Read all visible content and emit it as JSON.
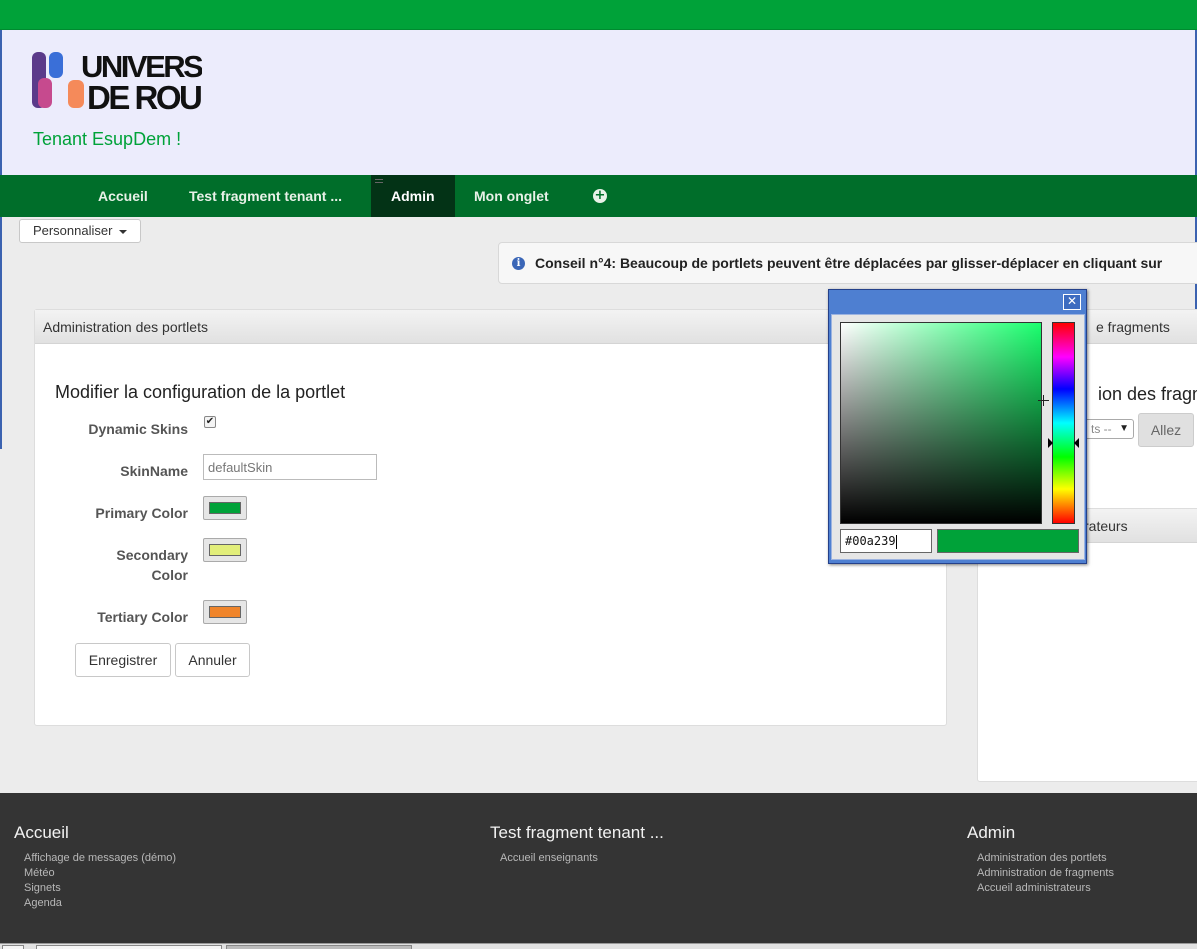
{
  "header": {
    "tenant_title": "Tenant EsupDem !",
    "logo_alt": "UNIVERSITÉ DE ROUEN",
    "logo_line1": "UNIVERSITÉ",
    "logo_line2": "DE ROUEN"
  },
  "nav": {
    "items": [
      {
        "label": "Accueil"
      },
      {
        "label": "Test fragment tenant ..."
      },
      {
        "label": "Admin"
      },
      {
        "label": "Mon onglet"
      }
    ],
    "add_icon": "plus-circle-icon"
  },
  "toolbar": {
    "personnaliser_label": "Personnaliser"
  },
  "tip": {
    "text": "Conseil n°4: Beaucoup de portlets peuvent être déplacées par glisser-déplacer en cliquant sur"
  },
  "portlet": {
    "header": "Administration des portlets",
    "form_title": "Modifier la configuration de la portlet",
    "fields": {
      "dynamic_skins_label": "Dynamic Skins",
      "dynamic_skins_checked": true,
      "skin_name_label": "SkinName",
      "skin_name_value": "defaultSkin",
      "primary_label": "Primary Color",
      "primary_color": "#00a239",
      "secondary_label_line1": "Secondary",
      "secondary_label_line2": "Color",
      "secondary_color": "#e2ee7a",
      "tertiary_label": "Tertiary Color",
      "tertiary_color": "#f0852b"
    },
    "save_label": "Enregistrer",
    "cancel_label": "Annuler"
  },
  "side_panel": {
    "header": "e fragments",
    "title": "ion des fragme",
    "select_value": "ts --",
    "go_label": "Allez",
    "panel2_header": "rateurs"
  },
  "color_picker": {
    "hex_value": "#00a239",
    "preview_color": "#00a239",
    "close_icon": "close-icon"
  },
  "footer": {
    "columns": [
      {
        "title": "Accueil",
        "links": [
          "Affichage de messages (démo)",
          "Météo",
          "Signets",
          "Agenda"
        ]
      },
      {
        "title": "Test fragment tenant ...",
        "links": [
          "Accueil enseignants"
        ]
      },
      {
        "title": "Admin",
        "links": [
          "Administration des portlets",
          "Administration de fragments",
          "Accueil administrateurs"
        ]
      }
    ]
  },
  "colors": {
    "brand_green": "#00a239",
    "nav_green": "#006e2a",
    "nav_active": "#033316",
    "header_bg": "#ececfc",
    "footer_bg": "#343434"
  }
}
